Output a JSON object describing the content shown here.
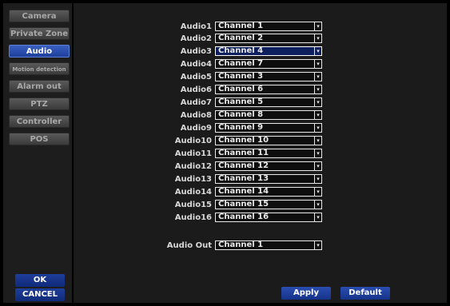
{
  "sidebar": {
    "items": [
      {
        "label": "Camera",
        "active": false
      },
      {
        "label": "Private Zone",
        "active": false
      },
      {
        "label": "Audio",
        "active": true
      },
      {
        "label": "Motion detection",
        "active": false
      },
      {
        "label": "Alarm out",
        "active": false
      },
      {
        "label": "PTZ",
        "active": false
      },
      {
        "label": "Controller",
        "active": false
      },
      {
        "label": "POS",
        "active": false
      }
    ],
    "ok_label": "OK",
    "cancel_label": "CANCEL"
  },
  "audio_rows": [
    {
      "label": "Audio1",
      "value": "Channel 1"
    },
    {
      "label": "Audio2",
      "value": "Channel 2"
    },
    {
      "label": "Audio3",
      "value": "Channel 4"
    },
    {
      "label": "Audio4",
      "value": "Channel 7"
    },
    {
      "label": "Audio5",
      "value": "Channel 3"
    },
    {
      "label": "Audio6",
      "value": "Channel 6"
    },
    {
      "label": "Audio7",
      "value": "Channel 5"
    },
    {
      "label": "Audio8",
      "value": "Channel 8"
    },
    {
      "label": "Audio9",
      "value": "Channel 9"
    },
    {
      "label": "Audio10",
      "value": "Channel 10"
    },
    {
      "label": "Audio11",
      "value": "Channel 11"
    },
    {
      "label": "Audio12",
      "value": "Channel 12"
    },
    {
      "label": "Audio13",
      "value": "Channel 13"
    },
    {
      "label": "Audio14",
      "value": "Channel 14"
    },
    {
      "label": "Audio15",
      "value": "Channel 15"
    },
    {
      "label": "Audio16",
      "value": "Channel 16"
    }
  ],
  "audio_out": {
    "label": "Audio Out",
    "value": "Channel 1"
  },
  "actions": {
    "apply_label": "Apply",
    "default_label": "Default"
  },
  "colors": {
    "active_accent": "#2a4db0",
    "panel": "#1b1b1b"
  }
}
